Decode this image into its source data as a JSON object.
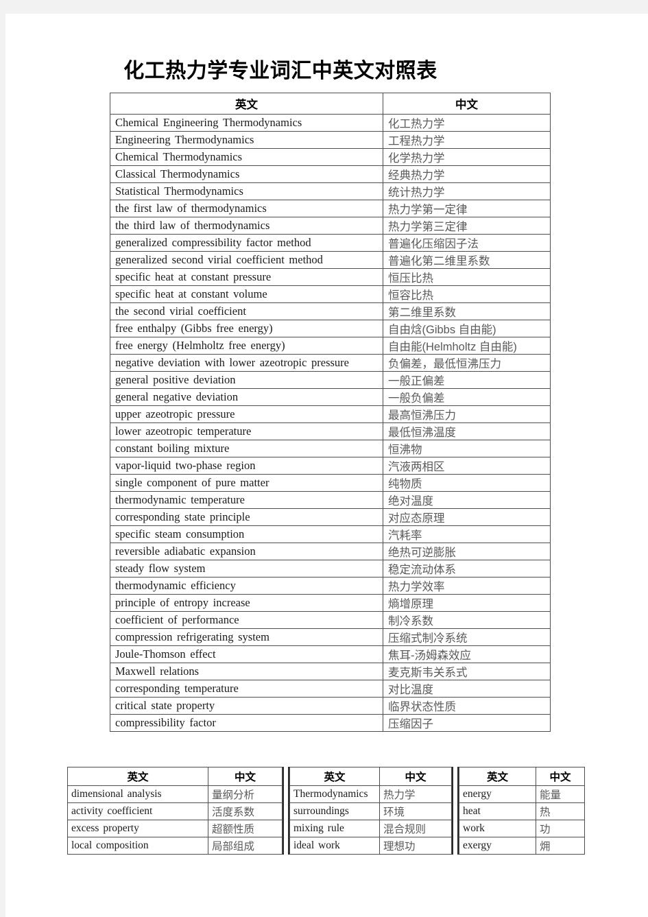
{
  "document": {
    "title": "化工热力学专业词汇中英文对照表"
  },
  "main_table": {
    "headers": {
      "english": "英文",
      "chinese": "中文"
    },
    "rows": [
      {
        "en": "Chemical Engineering Thermodynamics",
        "zh": "化工热力学"
      },
      {
        "en": "Engineering Thermodynamics",
        "zh": "工程热力学"
      },
      {
        "en": "Chemical Thermodynamics",
        "zh": "化学热力学"
      },
      {
        "en": "Classical Thermodynamics",
        "zh": "经典热力学"
      },
      {
        "en": "Statistical Thermodynamics",
        "zh": "统计热力学"
      },
      {
        "en": "the first law of thermodynamics",
        "zh": "热力学第一定律"
      },
      {
        "en": "the third law of thermodynamics",
        "zh": "热力学第三定律"
      },
      {
        "en": "generalized compressibility factor method",
        "zh": "普遍化压缩因子法"
      },
      {
        "en": "generalized second virial coefficient method",
        "zh": "普遍化第二维里系数"
      },
      {
        "en": "specific heat at constant pressure",
        "zh": "恒压比热"
      },
      {
        "en": "specific heat at constant volume",
        "zh": "恒容比热"
      },
      {
        "en": "the second virial coefficient",
        "zh": "第二维里系数"
      },
      {
        "en": "free enthalpy (Gibbs free energy)",
        "zh": "自由焓(Gibbs 自由能)"
      },
      {
        "en": "free energy (Helmholtz free energy)",
        "zh": "自由能(Helmholtz 自由能)"
      },
      {
        "en": "negative deviation with lower azeotropic pressure",
        "zh": "负偏差，最低恒沸压力"
      },
      {
        "en": "general positive deviation",
        "zh": "一般正偏差"
      },
      {
        "en": "general negative deviation",
        "zh": "一般负偏差"
      },
      {
        "en": "upper azeotropic pressure",
        "zh": "最高恒沸压力"
      },
      {
        "en": "lower azeotropic temperature",
        "zh": "最低恒沸温度"
      },
      {
        "en": "constant boiling mixture",
        "zh": "恒沸物"
      },
      {
        "en": "vapor-liquid two-phase region",
        "zh": "汽液两相区"
      },
      {
        "en": "single component of pure matter",
        "zh": "纯物质"
      },
      {
        "en": "thermodynamic temperature",
        "zh": "绝对温度"
      },
      {
        "en": "corresponding state principle",
        "zh": "对应态原理"
      },
      {
        "en": "specific steam consumption",
        "zh": "汽耗率"
      },
      {
        "en": "reversible adiabatic expansion",
        "zh": "绝热可逆膨胀"
      },
      {
        "en": "steady flow system",
        "zh": "稳定流动体系"
      },
      {
        "en": "thermodynamic efficiency",
        "zh": "热力学效率"
      },
      {
        "en": "principle of entropy increase",
        "zh": "熵增原理"
      },
      {
        "en": "coefficient of performance",
        "zh": "制冷系数"
      },
      {
        "en": "compression refrigerating system",
        "zh": "压缩式制冷系统"
      },
      {
        "en": "Joule-Thomson effect",
        "zh": "焦耳-汤姆森效应"
      },
      {
        "en": "Maxwell relations",
        "zh": "麦克斯韦关系式"
      },
      {
        "en": "corresponding temperature",
        "zh": "对比温度"
      },
      {
        "en": "critical state property",
        "zh": "临界状态性质"
      },
      {
        "en": "compressibility factor",
        "zh": "压缩因子"
      }
    ]
  },
  "bottom_panels": [
    {
      "headers": {
        "english": "英文",
        "chinese": "中文"
      },
      "rows": [
        {
          "en": "dimensional analysis",
          "zh": "量纲分析"
        },
        {
          "en": "activity coefficient",
          "zh": "活度系数"
        },
        {
          "en": "excess property",
          "zh": "超额性质"
        },
        {
          "en": "local composition",
          "zh": "局部组成"
        }
      ]
    },
    {
      "headers": {
        "english": "英文",
        "chinese": "中文"
      },
      "rows": [
        {
          "en": "Thermodynamics",
          "zh": "热力学"
        },
        {
          "en": "surroundings",
          "zh": "环境"
        },
        {
          "en": "mixing rule",
          "zh": "混合规则"
        },
        {
          "en": "ideal work",
          "zh": "理想功"
        }
      ]
    },
    {
      "headers": {
        "english": "英文",
        "chinese": "中文"
      },
      "rows": [
        {
          "en": "energy",
          "zh": "能量"
        },
        {
          "en": "heat",
          "zh": "热"
        },
        {
          "en": "work",
          "zh": "功"
        },
        {
          "en": "exergy",
          "zh": "㶲"
        }
      ]
    }
  ],
  "colors": {
    "page_background": "#ffffff",
    "margin_background": "#f2f2f2",
    "border": "#4d4d4d",
    "thick_separator": "#2b2b2b",
    "english_text": "#1b1b1b",
    "chinese_text": "#5a5a5a",
    "title_text": "#000000"
  }
}
